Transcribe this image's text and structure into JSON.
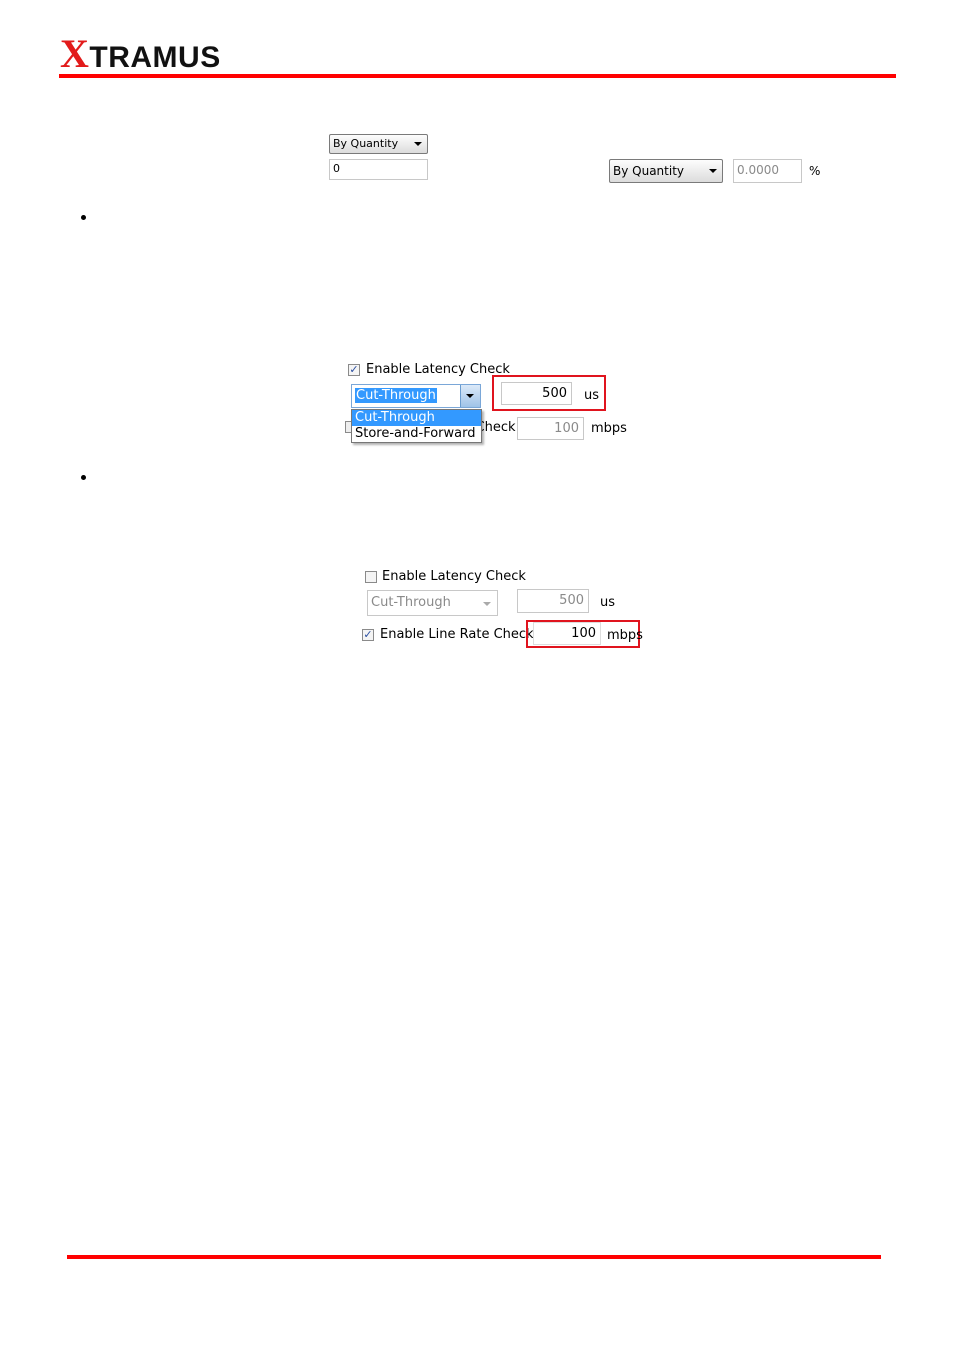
{
  "header": {
    "logo_text": "XTRAMUS",
    "logo_x": "X",
    "logo_rest": "TRAMUS"
  },
  "shot1": {
    "select1": "By Quantity",
    "input1": "0",
    "select2": "By Quantity",
    "input2": "0.0000",
    "unit": "%"
  },
  "shot2": {
    "latency_label": "Enable Latency Check",
    "latency_checked": true,
    "mode_value": "Cut-Through",
    "options": [
      "Cut-Through",
      "Store-and-Forward"
    ],
    "latency_value": "500",
    "latency_unit": "us",
    "linerate_label": "Enable Line Rate Check",
    "linerate_value": "100",
    "linerate_unit": "mbps"
  },
  "shot3": {
    "latency_label": "Enable Latency Check",
    "latency_checked": false,
    "mode_value": "Cut-Through",
    "latency_value": "500",
    "latency_unit": "us",
    "linerate_label": "Enable Line Rate Check",
    "linerate_checked": true,
    "linerate_value": "100",
    "linerate_unit": "mbps"
  },
  "colors": {
    "accent": "#ff0000",
    "highlight": "#3399ff"
  }
}
